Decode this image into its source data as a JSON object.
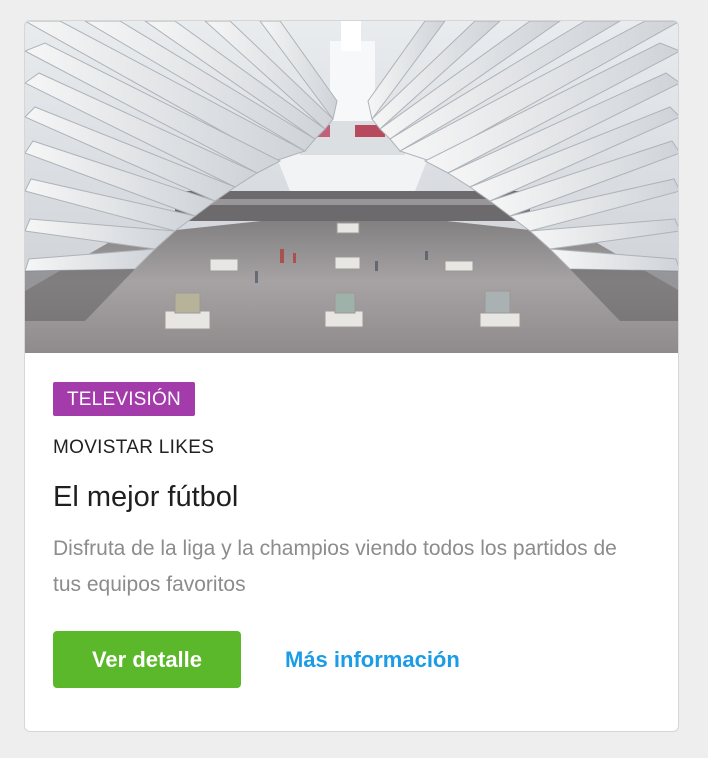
{
  "card": {
    "image_alt": "Interior arquitectónico con costillas blancas",
    "tag": "TELEVISIÓN",
    "brand": "MOVISTAR LIKES",
    "title": "El mejor fútbol",
    "description": "Disfruta de la liga y la champios viendo todos los partidos de tus equipos favoritos",
    "primary_button": "Ver detalle",
    "secondary_link": "Más información"
  },
  "colors": {
    "tag_background": "#a43bab",
    "primary_button": "#5bb82a",
    "link": "#1a9ce6",
    "description_text": "#8c8c8c"
  }
}
